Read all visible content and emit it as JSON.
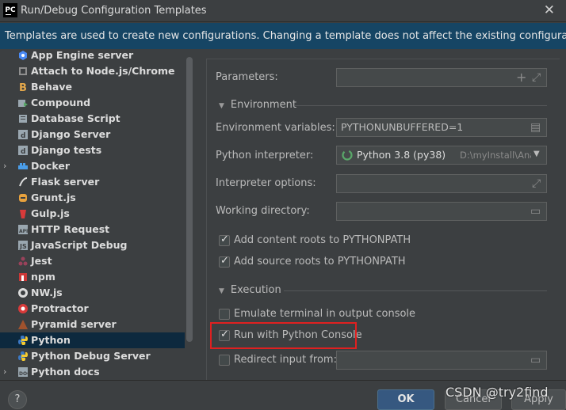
{
  "window": {
    "title": "Run/Debug Configuration Templates",
    "app_icon": "PC",
    "close_glyph": "✕"
  },
  "banner": {
    "text": "Templates are used to create new configurations. Changing a template does not affect the existing configurations."
  },
  "tree": {
    "items": [
      {
        "label": "App Engine server",
        "icon": "app-engine-icon",
        "expand": ""
      },
      {
        "label": "Attach to Node.js/Chrome",
        "icon": "attach-icon",
        "expand": ""
      },
      {
        "label": "Behave",
        "icon": "behave-icon",
        "expand": ""
      },
      {
        "label": "Compound",
        "icon": "compound-icon",
        "expand": ""
      },
      {
        "label": "Database Script",
        "icon": "database-icon",
        "expand": ""
      },
      {
        "label": "Django Server",
        "icon": "django-icon",
        "expand": ""
      },
      {
        "label": "Django tests",
        "icon": "django-tests-icon",
        "expand": ""
      },
      {
        "label": "Docker",
        "icon": "docker-icon",
        "expand": "›"
      },
      {
        "label": "Flask server",
        "icon": "flask-icon",
        "expand": ""
      },
      {
        "label": "Grunt.js",
        "icon": "grunt-icon",
        "expand": ""
      },
      {
        "label": "Gulp.js",
        "icon": "gulp-icon",
        "expand": ""
      },
      {
        "label": "HTTP Request",
        "icon": "http-request-icon",
        "expand": ""
      },
      {
        "label": "JavaScript Debug",
        "icon": "js-debug-icon",
        "expand": ""
      },
      {
        "label": "Jest",
        "icon": "jest-icon",
        "expand": ""
      },
      {
        "label": "npm",
        "icon": "npm-icon",
        "expand": ""
      },
      {
        "label": "NW.js",
        "icon": "nwjs-icon",
        "expand": ""
      },
      {
        "label": "Protractor",
        "icon": "protractor-icon",
        "expand": ""
      },
      {
        "label": "Pyramid server",
        "icon": "pyramid-icon",
        "expand": ""
      },
      {
        "label": "Python",
        "icon": "python-icon",
        "expand": "",
        "selected": true
      },
      {
        "label": "Python Debug Server",
        "icon": "python-debug-icon",
        "expand": ""
      },
      {
        "label": "Python docs",
        "icon": "python-docs-icon",
        "expand": "›"
      }
    ]
  },
  "form": {
    "parameters_label": "Parameters:",
    "parameters_value": "",
    "environment_section": "Environment",
    "env_vars_label": "Environment variables:",
    "env_vars_value": "PYTHONUNBUFFERED=1",
    "interpreter_label": "Python interpreter:",
    "interpreter_value": "Python 3.8 (py38)",
    "interpreter_path": "D:\\myInstall\\Anacond",
    "interpreter_options_label": "Interpreter options:",
    "interpreter_options_value": "",
    "working_dir_label": "Working directory:",
    "working_dir_value": "",
    "add_content_roots": {
      "label": "Add content roots to PYTHONPATH",
      "checked": true
    },
    "add_source_roots": {
      "label": "Add source roots to PYTHONPATH",
      "checked": true
    },
    "execution_section": "Execution",
    "emulate_terminal": {
      "label": "Emulate terminal in output console",
      "checked": false
    },
    "run_with_console": {
      "label": "Run with Python Console",
      "checked": true
    },
    "redirect_input": {
      "label": "Redirect input from:",
      "checked": false
    }
  },
  "buttons": {
    "help": "?",
    "ok": "OK",
    "cancel": "Cancel",
    "apply": "Apply"
  },
  "watermark": "CSDN @try2find",
  "colors": {
    "background": "#3c3f41",
    "banner": "#164564",
    "selection": "#0d293e",
    "ok_button": "#365880",
    "highlight_box": "#e02020"
  }
}
